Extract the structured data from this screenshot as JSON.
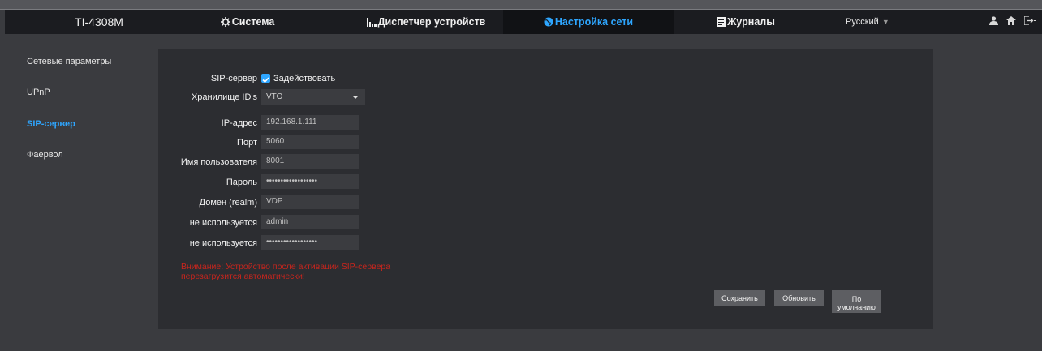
{
  "header": {
    "device": "TI-4308M",
    "nav": [
      {
        "label": "Система",
        "icon": "gear-icon"
      },
      {
        "label": "Диспетчер устройств",
        "icon": "device-manager-icon"
      },
      {
        "label": "Настройка сети",
        "icon": "globe-icon"
      },
      {
        "label": "Журналы",
        "icon": "log-icon"
      }
    ],
    "language": "Русский",
    "accent_color": "#2ea6ff"
  },
  "sidebar": {
    "items": [
      {
        "label": "Сетевые параметры"
      },
      {
        "label": "UPnP"
      },
      {
        "label": "SIP-сервер"
      },
      {
        "label": "Фаервол"
      }
    ]
  },
  "form": {
    "sip_server_label": "SIP-сервер",
    "enable_label": "Задействовать",
    "enabled": true,
    "id_storage_label": "Хранилище ID's",
    "id_storage_value": "VTO",
    "ip_label": "IP-адрес",
    "ip_value": "192.168.1.111",
    "port_label": "Порт",
    "port_value": "5060",
    "username_label": "Имя пользователя",
    "username_value": "8001",
    "password_label": "Пароль",
    "password_value": "••••••••••••••••••",
    "domain_label": "Домен (realm)",
    "domain_value": "VDP",
    "unused1_label": "не используется",
    "unused1_value": "admin",
    "unused2_label": "не используется",
    "unused2_value": "••••••••••••••••••",
    "warning": "Внимание: Устройство после активации SIP-сервера перезагрузится автоматически!",
    "warning_color": "#c8251d"
  },
  "buttons": {
    "save": "Сохранить",
    "refresh": "Обновить",
    "default_line1": "По",
    "default_line2": "умолчанию"
  }
}
